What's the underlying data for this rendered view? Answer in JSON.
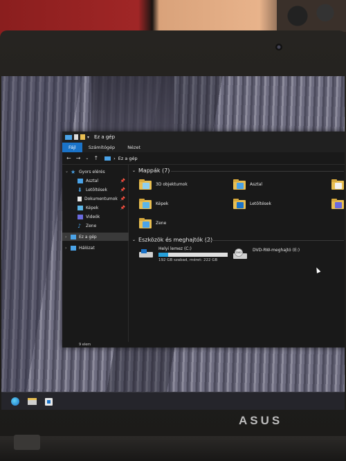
{
  "window": {
    "title": "Ez a gép",
    "ribbon_tabs": [
      "Fájl",
      "Számítógép",
      "Nézet"
    ],
    "address": "Ez a gép"
  },
  "sidebar": {
    "quick_access": "Gyors elérés",
    "items": [
      {
        "label": "Asztal",
        "icon": "desktop-icon"
      },
      {
        "label": "Letöltések",
        "icon": "download-icon"
      },
      {
        "label": "Dokumentumok",
        "icon": "document-icon"
      },
      {
        "label": "Képek",
        "icon": "picture-icon"
      },
      {
        "label": "Videók",
        "icon": "video-icon"
      },
      {
        "label": "Zene",
        "icon": "music-icon"
      }
    ],
    "this_pc": "Ez a gép",
    "network": "Hálózat"
  },
  "folders": {
    "header": "Mappák (7)",
    "items": [
      "3D objektumok",
      "Asztal",
      "Képek",
      "Letöltések",
      "Zene"
    ]
  },
  "devices": {
    "header": "Eszközök és meghajtók (2)",
    "local_disk": {
      "name": "Helyi lemez (C:)",
      "detail": "192 GB szabad, méret: 222 GB",
      "used_fraction": 0.14
    },
    "dvd": {
      "name": "DVD-RW-meghajtó (E:)",
      "badge": "DVD"
    }
  },
  "status": {
    "item_count": "9 elem"
  },
  "brand": "ASUS",
  "colors": {
    "accent": "#1a73c9",
    "folder": "#e9bf52",
    "drive_bar": "#26a0da"
  }
}
